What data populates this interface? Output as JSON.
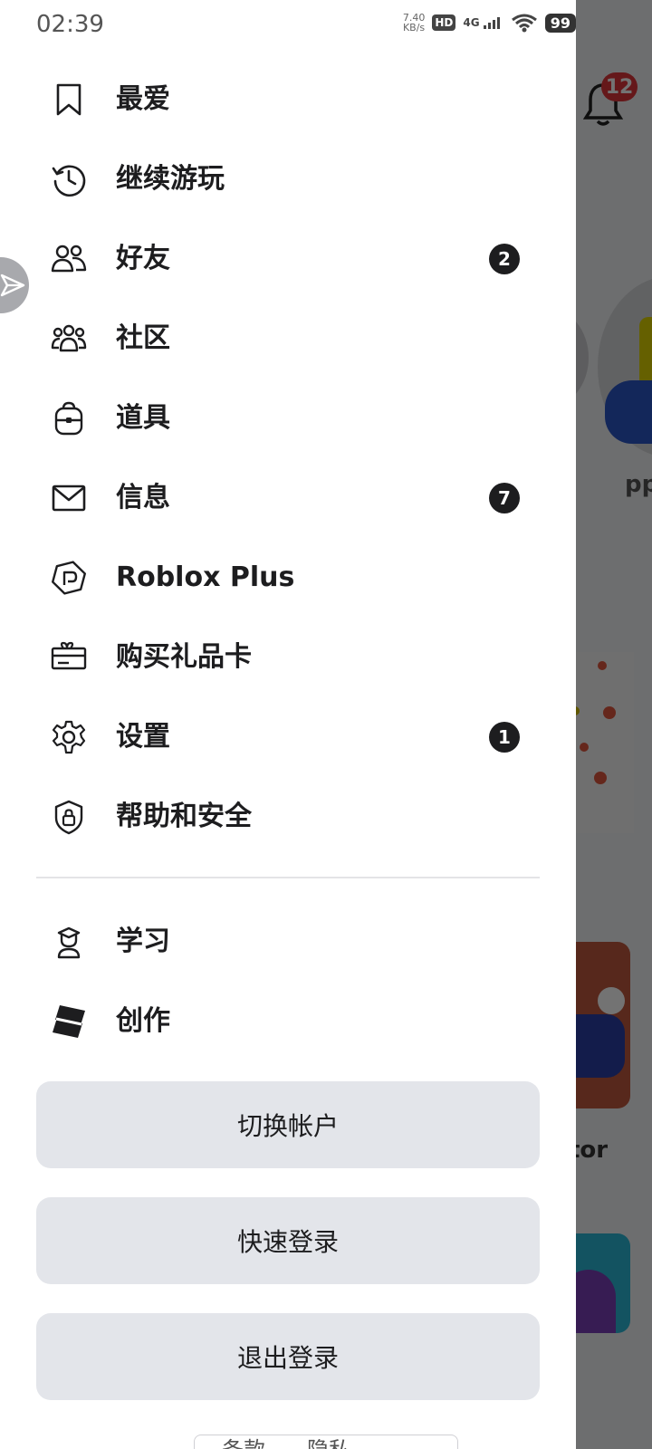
{
  "status_bar": {
    "time": "02:39",
    "speed_value": "7.40",
    "speed_unit": "KB/s",
    "hd": "HD",
    "network": "4G",
    "battery": "99"
  },
  "background": {
    "bell_badge": "12",
    "name_fragment": "pp",
    "caption_fragment": "tor"
  },
  "menu": {
    "items": [
      {
        "label": "最爱",
        "icon": "bookmark-icon"
      },
      {
        "label": "继续游玩",
        "icon": "history-icon"
      },
      {
        "label": "好友",
        "icon": "friends-icon",
        "badge": "2"
      },
      {
        "label": "社区",
        "icon": "community-icon"
      },
      {
        "label": "道具",
        "icon": "backpack-icon"
      },
      {
        "label": "信息",
        "icon": "mail-icon",
        "badge": "7"
      },
      {
        "label": "Roblox Plus",
        "icon": "roblox-plus-icon"
      },
      {
        "label": "购买礼品卡",
        "icon": "gift-card-icon"
      },
      {
        "label": "设置",
        "icon": "gear-icon",
        "badge": "1"
      },
      {
        "label": "帮助和安全",
        "icon": "shield-lock-icon"
      }
    ],
    "secondary": [
      {
        "label": "学习",
        "icon": "learn-icon"
      },
      {
        "label": "创作",
        "icon": "roblox-studio-icon"
      }
    ]
  },
  "buttons": {
    "switch_account": "切换帐户",
    "quick_login": "快速登录",
    "logout": "退出登录"
  },
  "footer": {
    "terms": "条款",
    "privacy": "隐私"
  },
  "colors": {
    "badge_dark": "#1d1d1f",
    "notification_red": "#e1363b",
    "button_bg": "#e3e5ea"
  }
}
